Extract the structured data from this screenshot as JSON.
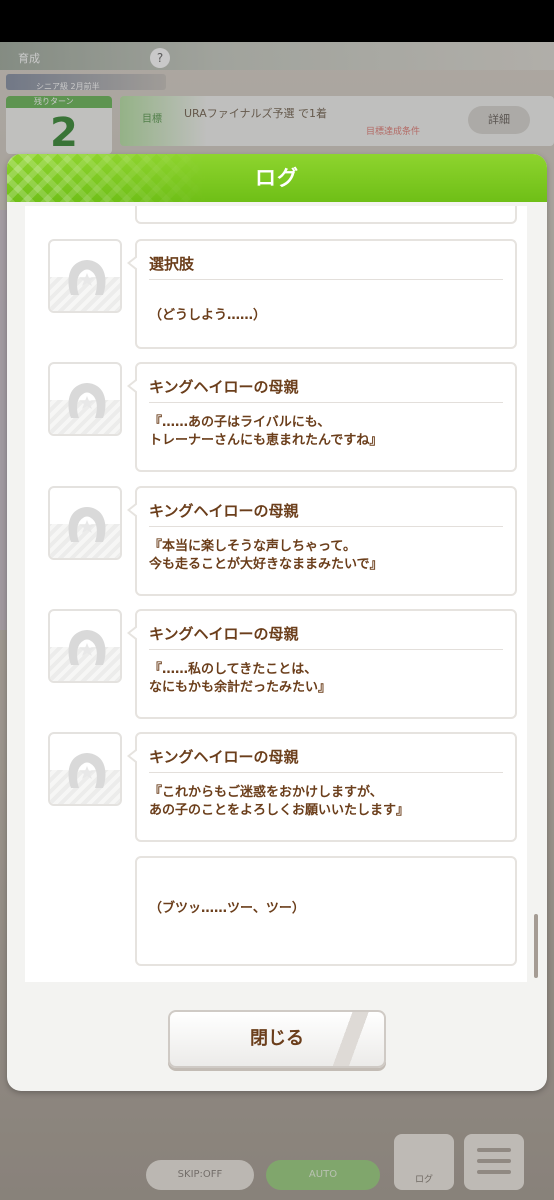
{
  "background": {
    "top_chip": "育成",
    "top_circle": "?",
    "sub_banner": "シニア級 2月前半",
    "turn_small": "残りターン",
    "turn_number": "2",
    "goal_label": "目標",
    "goal_title": "URAファイナルズ予選 で1着",
    "goal_sub": "目標達成条件",
    "goal_button": "詳細",
    "skip_button": "SKIP:OFF",
    "auto_button": "AUTO",
    "log_button": "ログ"
  },
  "dialog": {
    "title": "ログ",
    "close_label": "閉じる"
  },
  "log_entries": [
    {
      "speaker": "選択肢",
      "lines": [
        "（どうしよう……）"
      ]
    },
    {
      "speaker": "キングヘイローの母親",
      "lines": [
        "『……あの子はライバルにも、",
        "トレーナーさんにも恵まれたんですね』"
      ]
    },
    {
      "speaker": "キングヘイローの母親",
      "lines": [
        "『本当に楽しそうな声しちゃって。",
        "今も走ることが大好きなままみたいで』"
      ]
    },
    {
      "speaker": "キングヘイローの母親",
      "lines": [
        "『……私のしてきたことは、",
        "なにもかも余計だったみたい』"
      ]
    },
    {
      "speaker": "キングヘイローの母親",
      "lines": [
        "『これからもご迷惑をおかけしますが、",
        "あの子のことをよろしくお願いいたします』"
      ]
    },
    {
      "speaker": "",
      "lines": [
        "（ブツッ……ツー、ツー）"
      ]
    }
  ],
  "colors": {
    "header_green": "#7ac723",
    "text_brown": "#6b3e1b",
    "bubble_border": "#e6e3df"
  }
}
